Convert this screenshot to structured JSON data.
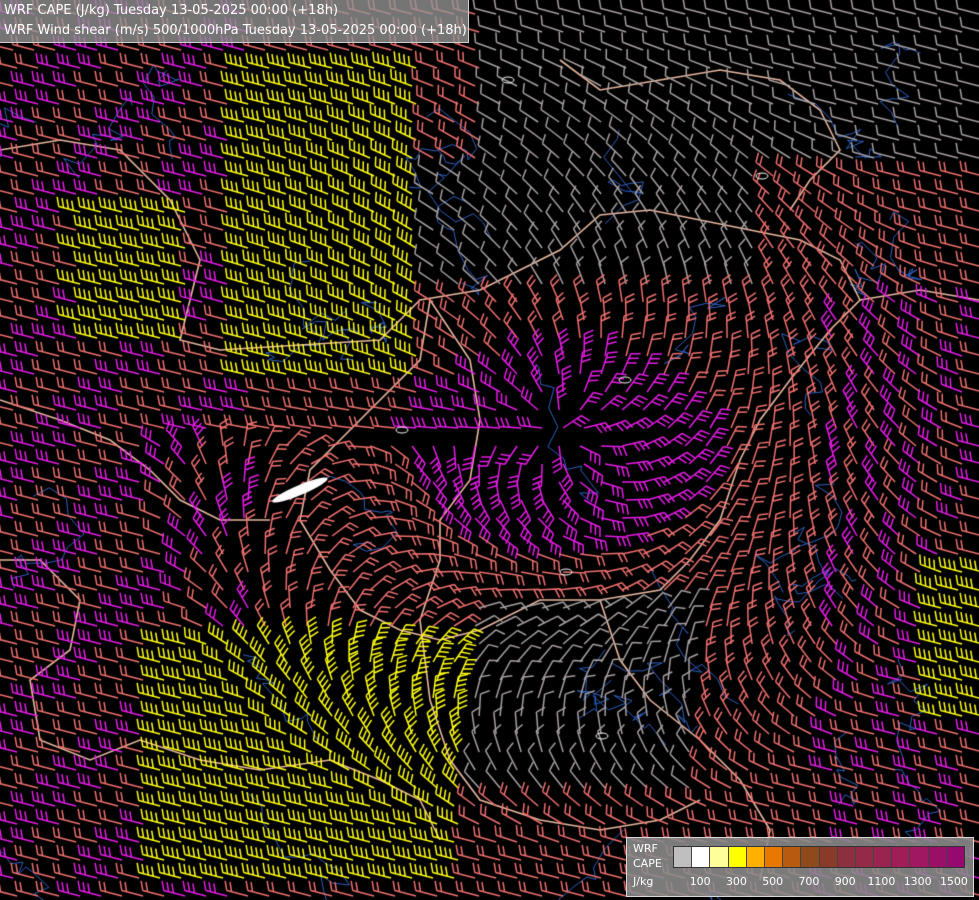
{
  "title": {
    "line1": "WRF CAPE (J/kg) Tuesday 13-05-2025 00:00 (+18h)",
    "line2": "WRF Wind shear (m/s) 500/1000hPa Tuesday 13-05-2025 00:00 (+18h)"
  },
  "legend": {
    "name_line1": "WRF",
    "name_line2": "CAPE",
    "unit": "J/kg",
    "tick_labels": [
      "100",
      "300",
      "500",
      "700",
      "900",
      "1100",
      "1300",
      "1500"
    ],
    "swatch_colors": [
      "#bfbfbf",
      "#ffffff",
      "#ffff9a",
      "#ffff00",
      "#ffb000",
      "#e87800",
      "#b85a10",
      "#8f4a1c",
      "#8a3a28",
      "#8c3040",
      "#952a48",
      "#9a2450",
      "#a01e58",
      "#a01860",
      "#9a1068",
      "#960a70"
    ]
  },
  "map": {
    "background_color": "#000000",
    "wind_barb_colors": {
      "weak_shear": "#a8a0a0",
      "moderate_shear": "#f07070",
      "strong_shear": "#e81ce8",
      "very_strong_shear": "#ffff10"
    },
    "border_color": "#e8b8a0",
    "river_color": "#3060c0",
    "lake_color": "#ffffff"
  }
}
